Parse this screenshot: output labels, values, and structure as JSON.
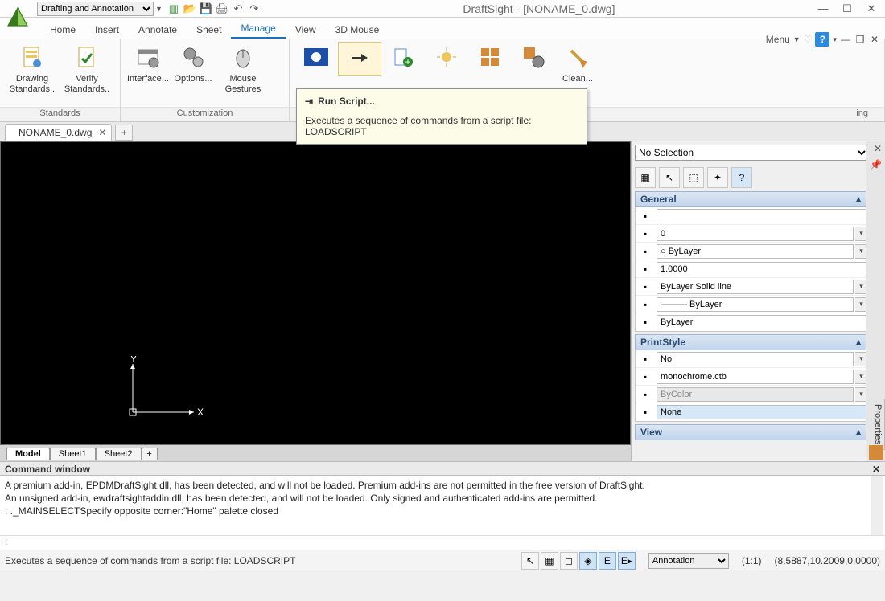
{
  "title": "DraftSight - [NONAME_0.dwg]",
  "workspace": "Drafting and Annotation",
  "menu_label": "Menu",
  "tabs": [
    "Home",
    "Insert",
    "Annotate",
    "Sheet",
    "Manage",
    "View",
    "3D Mouse"
  ],
  "active_tab": "Manage",
  "ribbon": {
    "groups": [
      {
        "label": "Standards",
        "buttons": [
          {
            "label": "Drawing Standards..",
            "icon": "standards-doc-icon"
          },
          {
            "label": "Verify Standards..",
            "icon": "standards-check-icon"
          }
        ]
      },
      {
        "label": "Customization",
        "buttons": [
          {
            "label": "Interface...",
            "icon": "interface-icon"
          },
          {
            "label": "Options...",
            "icon": "options-gear-icon"
          },
          {
            "label": "Mouse Gestures",
            "icon": "mouse-icon"
          }
        ]
      },
      {
        "label": "ing",
        "buttons": [
          {
            "label": "",
            "icon": "play-icon"
          },
          {
            "label": "",
            "icon": "run-script-icon",
            "hover": true
          },
          {
            "label": "",
            "icon": "script-add-icon"
          },
          {
            "label": "",
            "icon": "addin-sun-icon"
          },
          {
            "label": "",
            "icon": "addin-grid-icon"
          },
          {
            "label": "",
            "icon": "addin-gear-icon"
          },
          {
            "label": "Clean...",
            "icon": "broom-icon"
          }
        ]
      }
    ]
  },
  "tooltip": {
    "title": "Run Script...",
    "body": "Executes a sequence of commands from a script file:  LOADSCRIPT"
  },
  "doc_tab": "NONAME_0.dwg",
  "sheet_tabs": [
    "Model",
    "Sheet1",
    "Sheet2"
  ],
  "props": {
    "selection": "No Selection",
    "general_label": "General",
    "rows_general": [
      {
        "icon": "globe-icon",
        "value": "",
        "dd": false
      },
      {
        "icon": "layer-icon",
        "value": "0",
        "dd": true
      },
      {
        "icon": "color-swatch-icon",
        "value": "○ ByLayer",
        "dd": true
      },
      {
        "icon": "linescale-icon",
        "value": "1.0000",
        "dd": false
      },
      {
        "icon": "linetype-icon",
        "value": "ByLayer    Solid line",
        "dd": true
      },
      {
        "icon": "lineweight-icon",
        "value": "——— ByLayer",
        "dd": true
      },
      {
        "icon": "transparency-icon",
        "value": "ByLayer",
        "dd": false
      }
    ],
    "printstyle_label": "PrintStyle",
    "rows_print": [
      {
        "icon": "print-apply-icon",
        "value": "No",
        "dd": true
      },
      {
        "icon": "print-file-icon",
        "value": "monochrome.ctb",
        "dd": true
      },
      {
        "icon": "print-bycolor-icon",
        "value": "ByColor",
        "dd": true,
        "disabled": true
      },
      {
        "icon": "print-none-icon",
        "value": "None",
        "dd": false,
        "hl": true
      }
    ],
    "view_label": "View",
    "side_tab": "Properties"
  },
  "cmd": {
    "title": "Command window",
    "lines": [
      "A premium add-in, EPDMDraftSight.dll, has been detected, and will not be loaded. Premium add-ins are not permitted in the free version of DraftSight.",
      "An unsigned add-in, ewdraftsightaddin.dll, has been detected, and will not be loaded. Only signed and authenticated add-ins are permitted.",
      ": ._MAINSELECTSpecify opposite corner:\"Home\" palette closed"
    ],
    "prompt": ":"
  },
  "status": {
    "hint": "Executes a sequence of commands from a script file:  LOADSCRIPT",
    "mode": "Annotation",
    "scale": "(1:1)",
    "coords": "(8.5887,10.2009,0.0000)"
  },
  "ucs": {
    "x": "X",
    "y": "Y"
  }
}
